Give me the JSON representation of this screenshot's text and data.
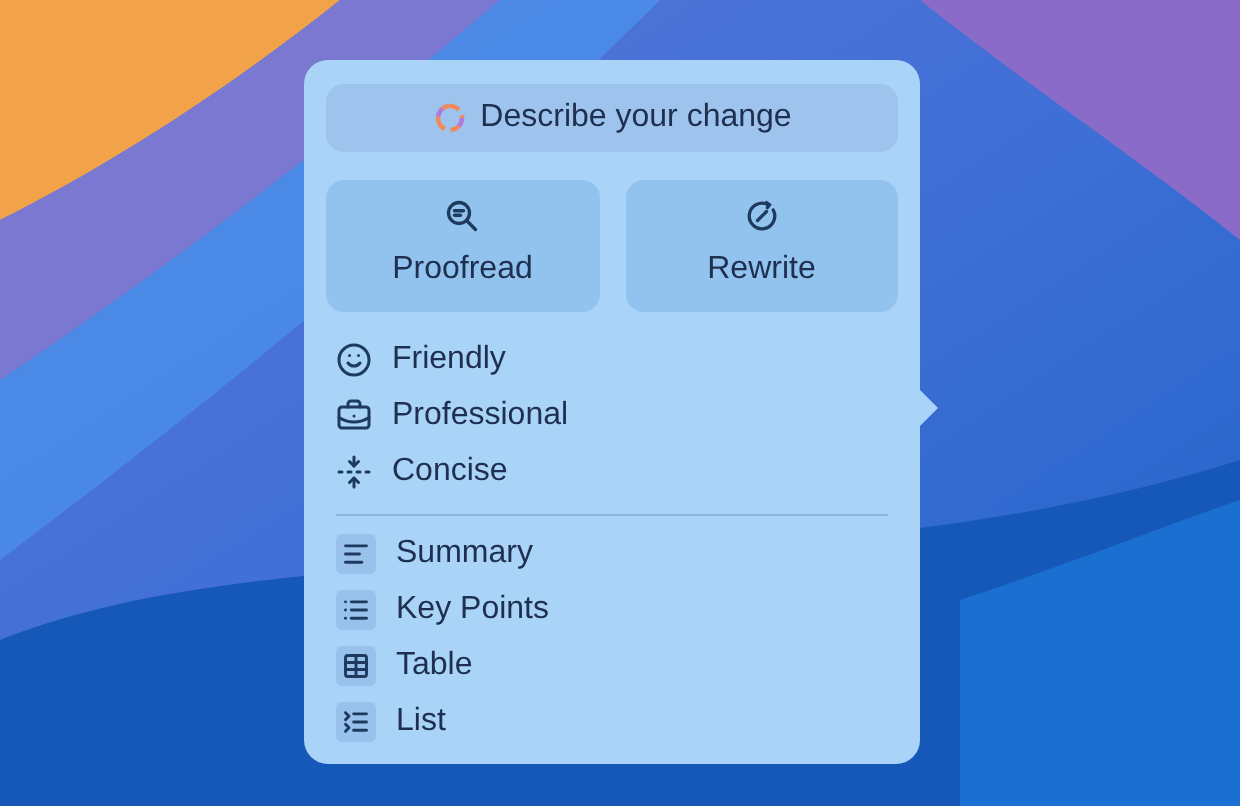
{
  "prompt_field": {
    "placeholder": "Describe your change"
  },
  "actions": [
    {
      "label": "Proofread"
    },
    {
      "label": "Rewrite"
    }
  ],
  "tones": [
    {
      "label": "Friendly"
    },
    {
      "label": "Professional"
    },
    {
      "label": "Concise"
    }
  ],
  "formats": [
    {
      "label": "Summary"
    },
    {
      "label": "Key Points"
    },
    {
      "label": "Table"
    },
    {
      "label": "List"
    }
  ]
}
